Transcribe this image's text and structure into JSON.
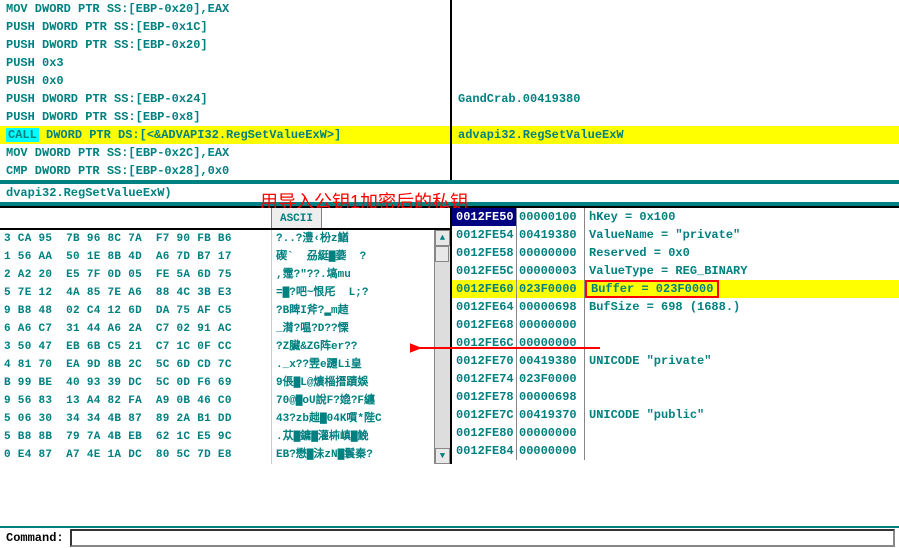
{
  "disasm": [
    {
      "code": "MOV DWORD PTR SS:[EBP-0x20],EAX",
      "comment": "",
      "hl": false
    },
    {
      "code": "PUSH DWORD PTR SS:[EBP-0x1C]",
      "comment": "",
      "hl": false
    },
    {
      "code": "PUSH DWORD PTR SS:[EBP-0x20]",
      "comment": "",
      "hl": false
    },
    {
      "code": "PUSH 0x3",
      "comment": "",
      "hl": false
    },
    {
      "code": "PUSH 0x0",
      "comment": "",
      "hl": false
    },
    {
      "code": "PUSH DWORD PTR SS:[EBP-0x24]",
      "comment": "GandCrab.00419380",
      "hl": false
    },
    {
      "code": "PUSH DWORD PTR SS:[EBP-0x8]",
      "comment": "",
      "hl": false
    },
    {
      "code": " DWORD PTR DS:[<&ADVAPI32.RegSetValueExW>]",
      "comment": "advapi32.RegSetValueExW",
      "hl": true,
      "kw": "CALL"
    },
    {
      "code": "MOV DWORD PTR SS:[EBP-0x2C],EAX",
      "comment": "",
      "hl": false
    },
    {
      "code": "CMP DWORD PTR SS:[EBP-0x28],0x0",
      "comment": "",
      "hl": false
    }
  ],
  "info_line": "dvapi32.RegSetValueExW)",
  "annotation": "用导入公钥1加密后的私钥",
  "ascii_header": "ASCII",
  "hex": [
    {
      "b": "3 CA 95  7B 96 8C 7A  F7 90 FB B6",
      "a": "?..?澧‹枌z鰌"
    },
    {
      "b": "1 56 AA  50 1E 8B 4D  A6 7D B7 17",
      "a": "碶`  刕綎▇嬊  ?"
    },
    {
      "b": "2 A2 20  E5 7F 0D 05  FE 5A 6D 75",
      "a": ",霪?\"??.塙mu"
    },
    {
      "b": "5 7E 12  4A 85 7E A6  88 4C 3B E3",
      "a": "=▇?吧~恨厇  L;?"
    },
    {
      "b": "9 B8 48  02 C4 12 6D  DA 75 AF C5",
      "a": "?B睥I斧?▂m趌"
    },
    {
      "b": "6 A6 C7  31 44 A6 2A  C7 02 91 AC",
      "a": "_潸?嗢?D??慄"
    },
    {
      "b": "3 50 47  EB 6B C5 21  C7 1C 0F CC",
      "a": "?Z臟&ZG阵er??"
    },
    {
      "b": "4 81 70  EA 9D 8B 2C  5C 6D CD 7C",
      "a": "._x??雴e躚Li皇"
    },
    {
      "b": "B 99 BE  40 93 39 DC  5C 0D F6 69",
      "a": "9倀▇L@爌椔搢蹟娛"
    },
    {
      "b": "9 56 83  13 A4 82 FA  A9 0B 46 C0",
      "a": "70@▇oU說F?嫓?F纏"
    },
    {
      "b": "5 06 30  34 34 4B 87  89 2A B1 DD",
      "a": "43?zb趉▇04K嘪*陛C"
    },
    {
      "b": "5 B8 8B  79 7A 4B EB  62 1C E5 9C",
      "a": ".苁▇鏞▇灌枾嵮▇鮸"
    },
    {
      "b": "0 E4 87  A7 4E 1A DC  80 5C 7D E8",
      "a": "EB?懋▇沬zN▇鬟秦?"
    }
  ],
  "stack": [
    {
      "addr": "0012FE50",
      "val": "00000100",
      "note": "hKey = 0x100",
      "sel": true
    },
    {
      "addr": "0012FE54",
      "val": "00419380",
      "note": "ValueName = \"private\"",
      "sel": false
    },
    {
      "addr": "0012FE58",
      "val": "00000000",
      "note": "Reserved = 0x0",
      "sel": false
    },
    {
      "addr": "0012FE5C",
      "val": "00000003",
      "note": "ValueType = REG_BINARY",
      "sel": false
    },
    {
      "addr": "0012FE60",
      "val": "023F0000",
      "note": "Buffer = 023F0000",
      "sel": false,
      "buf": true
    },
    {
      "addr": "0012FE64",
      "val": "00000698",
      "note": "BufSize = 698 (1688.)",
      "sel": false
    },
    {
      "addr": "0012FE68",
      "val": "00000000",
      "note": "",
      "sel": false
    },
    {
      "addr": "0012FE6C",
      "val": "00000000",
      "note": "",
      "sel": false
    },
    {
      "addr": "0012FE70",
      "val": "00419380",
      "note": "UNICODE \"private\"",
      "sel": false
    },
    {
      "addr": "0012FE74",
      "val": "023F0000",
      "note": "",
      "sel": false
    },
    {
      "addr": "0012FE78",
      "val": "00000698",
      "note": "",
      "sel": false
    },
    {
      "addr": "0012FE7C",
      "val": "00419370",
      "note": "UNICODE \"public\"",
      "sel": false
    },
    {
      "addr": "0012FE80",
      "val": "00000000",
      "note": "",
      "sel": false
    },
    {
      "addr": "0012FE84",
      "val": "00000000",
      "note": "",
      "sel": false
    }
  ],
  "command_label": "Command:"
}
